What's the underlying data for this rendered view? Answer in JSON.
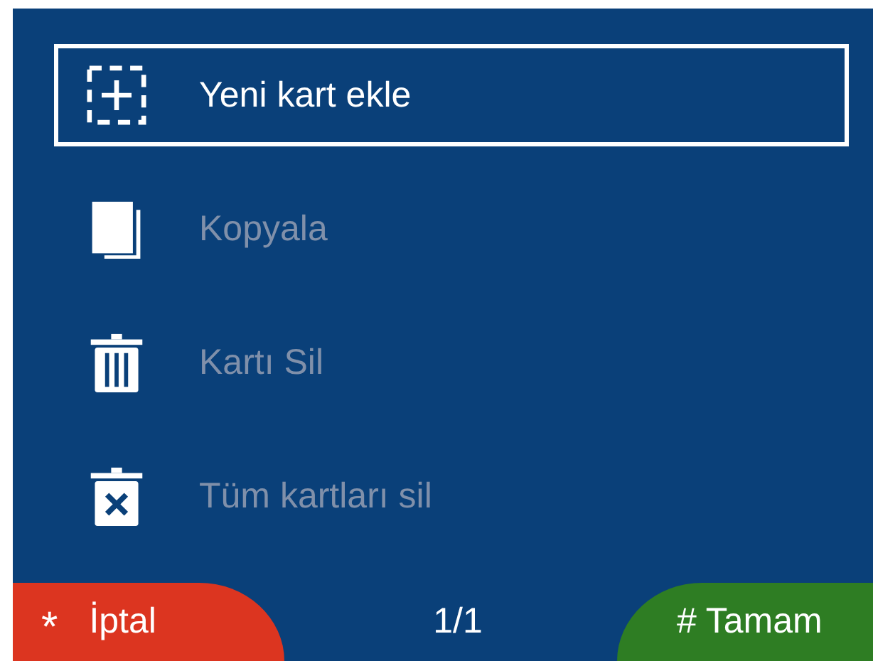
{
  "menu": [
    {
      "kind": "add",
      "label": "Yeni kart ekle",
      "selected": true,
      "disabled": false
    },
    {
      "kind": "copy",
      "label": "Kopyala",
      "selected": false,
      "disabled": true
    },
    {
      "kind": "delete",
      "label": "Kartı Sil",
      "selected": false,
      "disabled": true
    },
    {
      "kind": "delete_all",
      "label": "Tüm kartları sil",
      "selected": false,
      "disabled": true
    }
  ],
  "softkeys": {
    "left": {
      "key": "*",
      "label": "İptal"
    },
    "center": "1/1",
    "right": {
      "key": "#",
      "label": "Tamam"
    }
  }
}
